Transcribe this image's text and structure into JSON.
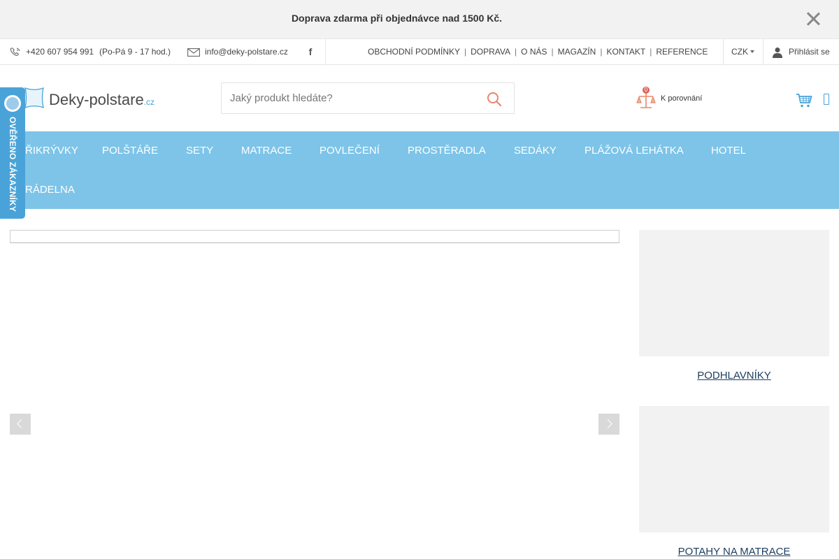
{
  "announcement": {
    "text": "Doprava zdarma při objednávce nad 1500 Kč."
  },
  "utility": {
    "phone": "+420 607 954 991",
    "hours": "(Po-Pá 9 - 17 hod.)",
    "email": "info@deky-polstare.cz",
    "links": [
      "OBCHODNÍ PODMÍNKY",
      "DOPRAVA",
      "O NÁS",
      "MAGAZÍN",
      "KONTAKT",
      "REFERENCE"
    ],
    "separator": "|",
    "currency": "CZK",
    "login": "Přihlásit se"
  },
  "header": {
    "logo_name": "Deky-polstare",
    "logo_tld": ".cz",
    "search_placeholder": "Jaký produkt hledáte?",
    "compare_count": "0",
    "compare_label": "K porovnání"
  },
  "nav": {
    "items": [
      "PŘIKRÝVKY",
      "POLŠTÁŘE",
      "SETY",
      "MATRACE",
      "POVLEČENÍ",
      "PROSTĚRADLA",
      "SEDÁKY",
      "PLÁŽOVÁ LEHÁTKA",
      "HOTEL",
      "PRÁDELNA"
    ]
  },
  "verified": {
    "label": "OVĚŘENO ZÁKAZNÍKY"
  },
  "side_tiles": [
    {
      "label": "PODHLAVNÍKY"
    },
    {
      "label": "POTAHY NA MATRACE"
    }
  ],
  "colors": {
    "nav_bg": "#7dc4e8",
    "brand_blue": "#4aa3d8",
    "accent_orange": "#e8866a",
    "link_navy": "#1c3f60"
  },
  "icons": {
    "phone": "phone-icon",
    "mail": "mail-icon",
    "facebook": "facebook-icon",
    "user": "user-icon",
    "search": "search-icon",
    "compare": "scales-icon",
    "cart": "cart-icon",
    "close": "close-icon"
  }
}
